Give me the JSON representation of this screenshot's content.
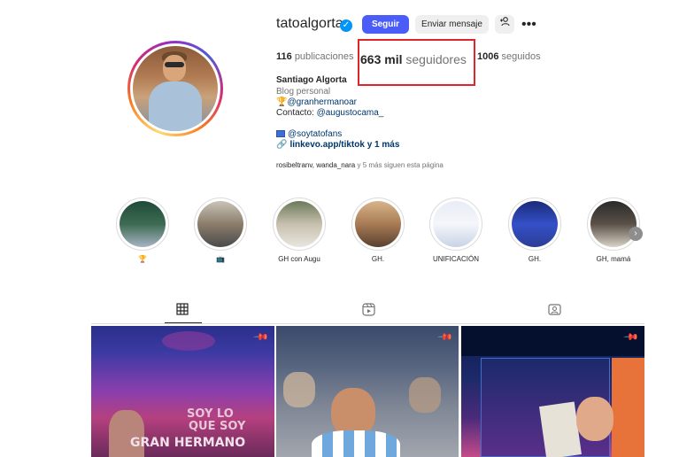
{
  "profile": {
    "username": "tatoalgorta",
    "verified_glyph": "✓",
    "follow_label": "Seguir",
    "message_label": "Enviar mensaje",
    "add_user_glyph": "+ᴿ",
    "more_glyph": "•••",
    "posts_count": "116",
    "posts_label": "publicaciones",
    "followers_count": "663 mil",
    "followers_label": "seguidores",
    "following_count": "1006",
    "following_label": "seguidos",
    "full_name": "Santiago Algorta",
    "category": "Blog personal",
    "bio_line1": "🏆@granhermanoar",
    "contact_prefix": "Contacto: ",
    "contact_handle": "@augustocama_",
    "bio_link2": "@soytatofans",
    "bio_link3": "linkevo.app/tiktok y 1 más",
    "followed_by_names": "rosibeltranv, wanda_nara",
    "followed_by_rest": " y 5 más siguen esta página"
  },
  "highlights": [
    {
      "label": "🏆"
    },
    {
      "label": "📺"
    },
    {
      "label": "GH con Augu"
    },
    {
      "label": "GH."
    },
    {
      "label": "UNIFICACIÓN"
    },
    {
      "label": "GH."
    },
    {
      "label": "GH, mamá"
    }
  ],
  "tabs": [
    "posts-grid",
    "reels",
    "tagged"
  ],
  "posts": [
    {
      "overlay_1": "SOY LO",
      "overlay_2": "QUE SOY",
      "overlay_3": "GRAN HERMANO"
    },
    {},
    {}
  ],
  "colors": {
    "accent": "#4a5df9",
    "verified": "#0095f6",
    "highlight_box": "#e0242b"
  }
}
